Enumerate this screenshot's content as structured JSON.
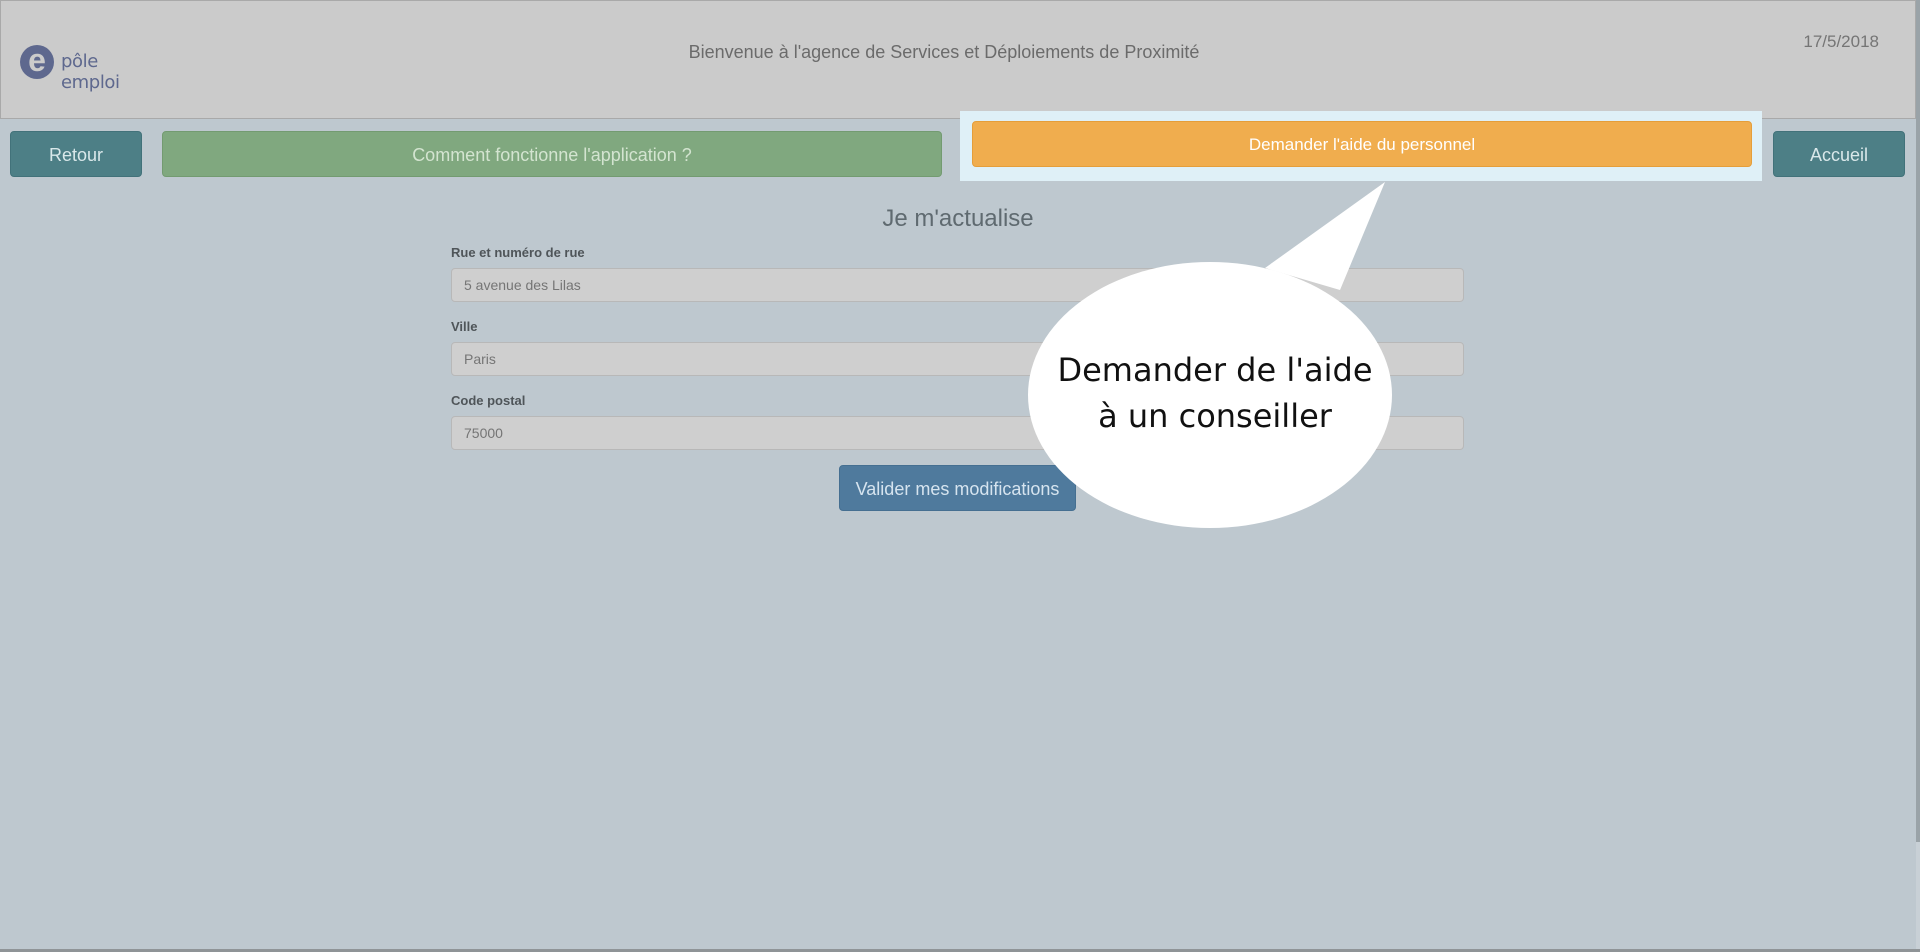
{
  "header": {
    "logo_text": "pôle emploi",
    "logo_mark": "e",
    "welcome": "Bienvenue à l'agence de Services et Déploiements de Proximité",
    "date": "17/5/2018"
  },
  "nav": {
    "back_label": "Retour",
    "how_label": "Comment fonctionne l'application ?",
    "help_label": "Demander l'aide du personnel",
    "home_label": "Accueil"
  },
  "form": {
    "title": "Je m'actualise",
    "street_label": "Rue et numéro de rue",
    "street_placeholder": "5 avenue des Lilas",
    "city_label": "Ville",
    "city_placeholder": "Paris",
    "postal_label": "Code postal",
    "postal_placeholder": "75000",
    "submit_label": "Valider mes modifications"
  },
  "callout": {
    "line1": "Demander de l'aide",
    "line2": "à un conseiller"
  },
  "colors": {
    "background": "#bec8cf",
    "header": "#cbcbcb",
    "teal_button": "#4d7f86",
    "green_button": "#80a87f",
    "orange_button": "#f0ad4e",
    "submit_button": "#4f7a9d",
    "highlight": "#dff0f7"
  }
}
